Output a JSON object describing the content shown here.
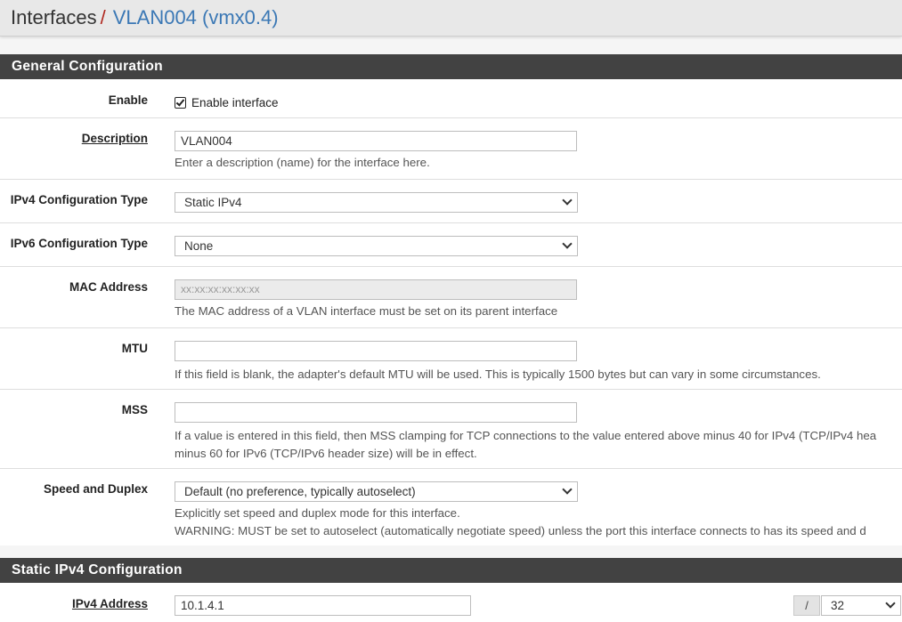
{
  "breadcrumb": {
    "root": "Interfaces",
    "separator": "/",
    "current": "VLAN004 (vmx0.4)"
  },
  "general": {
    "heading": "General Configuration",
    "enable": {
      "label": "Enable",
      "checkbox_label": "Enable interface",
      "checked": true
    },
    "description": {
      "label": "Description",
      "value": "VLAN004",
      "help": "Enter a description (name) for the interface here."
    },
    "ipv4_type": {
      "label": "IPv4 Configuration Type",
      "value": "Static IPv4"
    },
    "ipv6_type": {
      "label": "IPv6 Configuration Type",
      "value": "None"
    },
    "mac": {
      "label": "MAC Address",
      "placeholder": "xx:xx:xx:xx:xx:xx",
      "help": "The MAC address of a VLAN interface must be set on its parent interface"
    },
    "mtu": {
      "label": "MTU",
      "value": "",
      "help": "If this field is blank, the adapter's default MTU will be used. This is typically 1500 bytes but can vary in some circumstances."
    },
    "mss": {
      "label": "MSS",
      "value": "",
      "help_line1": "If a value is entered in this field, then MSS clamping for TCP connections to the value entered above minus 40 for IPv4 (TCP/IPv4 hea",
      "help_line2": "minus 60 for IPv6 (TCP/IPv6 header size) will be in effect."
    },
    "speed": {
      "label": "Speed and Duplex",
      "value": "Default (no preference, typically autoselect)",
      "help_line1": "Explicitly set speed and duplex mode for this interface.",
      "help_line2": "WARNING: MUST be set to autoselect (automatically negotiate speed) unless the port this interface connects to has its speed and d"
    }
  },
  "static_ipv4": {
    "heading": "Static IPv4 Configuration",
    "address": {
      "label": "IPv4 Address",
      "value": "10.1.4.1",
      "separator": "/",
      "mask": "32"
    }
  }
}
